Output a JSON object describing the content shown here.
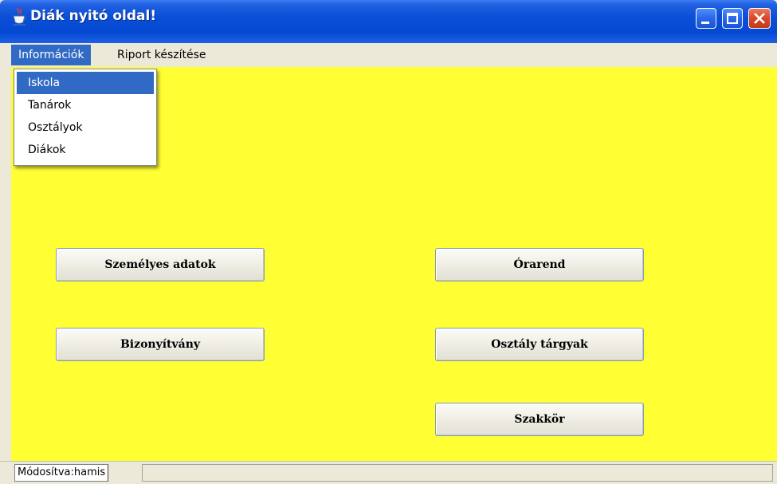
{
  "window": {
    "title": "Diák nyitó oldal!",
    "app_icon": "java-cup-icon",
    "controls": [
      "minimize-icon",
      "maximize-icon",
      "close-icon"
    ]
  },
  "menubar": {
    "items": [
      {
        "label": "Információk",
        "active": true
      },
      {
        "label": "Riport készítése",
        "active": false
      }
    ]
  },
  "dropdown": {
    "items": [
      {
        "label": "Iskola",
        "selected": true
      },
      {
        "label": "Tanárok",
        "selected": false
      },
      {
        "label": "Osztályok",
        "selected": false
      },
      {
        "label": "Diákok",
        "selected": false
      }
    ]
  },
  "buttons": {
    "szemelyes_adatok": "Személyes adatok",
    "bizonyitvany": "Bizonyítvány",
    "orarend": "Órarend",
    "osztaly_targyak": "Osztály tárgyak",
    "szakkor": "Szakkör"
  },
  "statusbar": {
    "text": "Módosítva:hamis"
  },
  "colors": {
    "content_background": "#ffff33",
    "title_bar": "#0a4fd6",
    "selection": "#316ac5"
  }
}
